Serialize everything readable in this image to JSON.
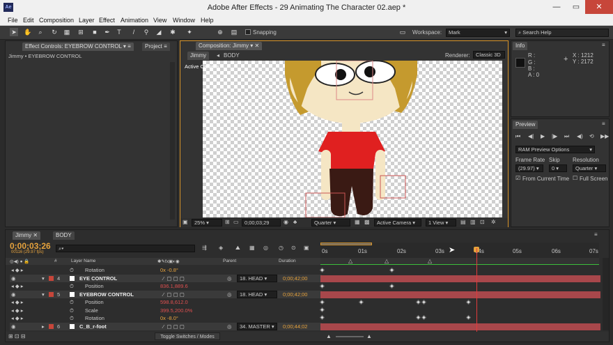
{
  "window": {
    "title": "Adobe After Effects - 29 Animating The Character 02.aep *",
    "logo": "Ae"
  },
  "menu": [
    "File",
    "Edit",
    "Composition",
    "Layer",
    "Effect",
    "Animation",
    "View",
    "Window",
    "Help"
  ],
  "toolbar": {
    "snapping": "Snapping",
    "workspace_label": "Workspace:",
    "workspace_value": "Mark",
    "search": "Search Help"
  },
  "effect_controls": {
    "tab": "Effect Controls: EYEBROW CONTROL",
    "project_tab": "Project",
    "breadcrumb": "Jimmy • EYEBROW CONTROL"
  },
  "composition": {
    "tab": "Composition: Jimmy",
    "crumb1": "Jimmy",
    "crumb2": "BODY",
    "renderer_label": "Renderer:",
    "renderer_value": "Classic 3D",
    "active_camera_label": "Active Camera"
  },
  "viewer_bar": {
    "zoom": "25%",
    "timecode": "0;00;03;29",
    "quality": "Quarter",
    "camera": "Active Camera",
    "views": "1 View"
  },
  "info": {
    "tab": "Info",
    "r": "R :",
    "g": "G :",
    "b": "B :",
    "a": "A : 0",
    "x": "X : 1212",
    "y": "Y : 2172"
  },
  "preview": {
    "tab": "Preview",
    "ram_options": "RAM Preview Options",
    "frame_rate_label": "Frame Rate",
    "skip_label": "Skip",
    "resolution_label": "Resolution",
    "frame_rate": "(29.97)",
    "skip": "0",
    "resolution": "Quarter",
    "from_current": "From Current Time",
    "full_screen": "Full Screen"
  },
  "timeline": {
    "tabs": [
      "Jimmy",
      "BODY"
    ],
    "timecode": "0;00;03;26",
    "fps": "00116 (29.97 fps)",
    "col_layer": "Layer Name",
    "col_parent": "Parent",
    "col_duration": "Duration",
    "ruler": [
      "0s",
      "01s",
      "02s",
      "03s",
      "04s",
      "05s",
      "06s",
      "07s"
    ],
    "toggle": "Toggle Switches / Modes",
    "rows": [
      {
        "num": "",
        "name": "Rotation",
        "value": "0x -0.8°",
        "type": "prop"
      },
      {
        "num": "4",
        "name": "EYE CONTROL",
        "parent": "18. HEAD",
        "duration": "0;00;42;00",
        "type": "layer"
      },
      {
        "num": "",
        "name": "Position",
        "value": "836.1,889.6",
        "type": "prop"
      },
      {
        "num": "5",
        "name": "EYEBROW CONTROL",
        "parent": "18. HEAD",
        "duration": "0;00;42;00",
        "type": "layer"
      },
      {
        "num": "",
        "name": "Position",
        "value": "598.8,612.0",
        "type": "prop"
      },
      {
        "num": "",
        "name": "Scale",
        "value": "399.5,200.0%",
        "type": "prop"
      },
      {
        "num": "",
        "name": "Rotation",
        "value": "0x -8.0°",
        "type": "prop"
      },
      {
        "num": "6",
        "name": "C_B_r-foot",
        "parent": "34. MASTER",
        "duration": "0;00;44;02",
        "type": "layer"
      }
    ]
  },
  "colors": {
    "accent": "#e6a23c",
    "label_red": "#c7463a",
    "bar": "#a8474b",
    "playhead": "#e23b3b"
  }
}
